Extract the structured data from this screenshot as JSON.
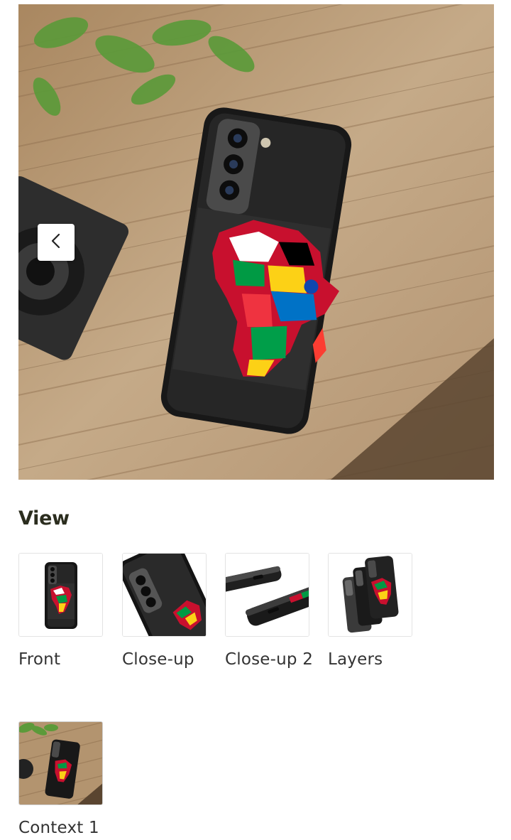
{
  "gallery": {
    "main_image": "phone-case-context-photo",
    "prev_icon": "chevron-left-icon"
  },
  "views": {
    "title": "View",
    "items": [
      {
        "label": "Front"
      },
      {
        "label": "Close-up"
      },
      {
        "label": "Close-up 2"
      },
      {
        "label": "Layers"
      },
      {
        "label": "Context 1"
      }
    ]
  },
  "colors": {
    "title": "#2b2d1e",
    "wood": "#b89a76",
    "case": "#1c1c1c"
  }
}
